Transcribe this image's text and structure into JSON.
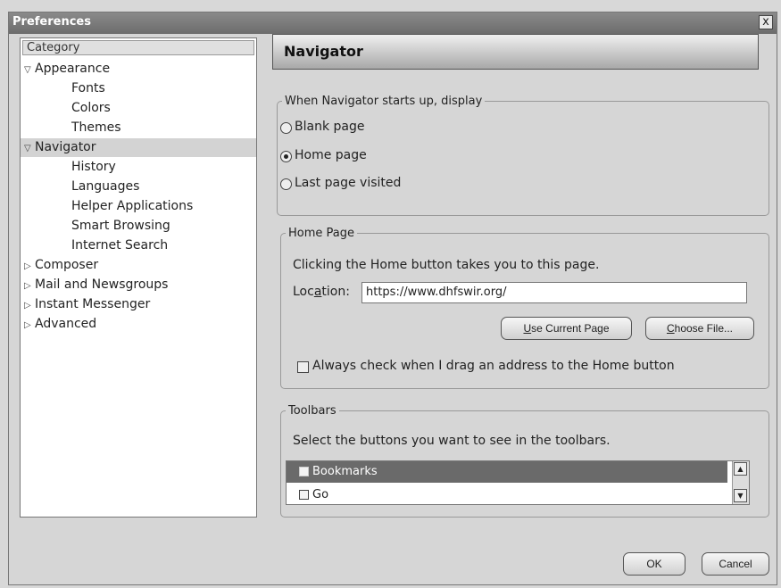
{
  "window": {
    "title": "Preferences",
    "close_label": "x"
  },
  "sidebar": {
    "header": "Category",
    "items": [
      {
        "label": "Appearance",
        "twisty": "▽"
      },
      {
        "label": "Fonts"
      },
      {
        "label": "Colors"
      },
      {
        "label": "Themes"
      },
      {
        "label": "Navigator",
        "twisty": "▽"
      },
      {
        "label": "History"
      },
      {
        "label": "Languages"
      },
      {
        "label": "Helper Applications"
      },
      {
        "label": "Smart Browsing"
      },
      {
        "label": "Internet Search"
      },
      {
        "label": "Composer",
        "twisty": "▷"
      },
      {
        "label": "Mail and Newsgroups",
        "twisty": "▷"
      },
      {
        "label": "Instant Messenger",
        "twisty": "▷"
      },
      {
        "label": "Advanced",
        "twisty": "▷"
      }
    ]
  },
  "panel": {
    "title": "Navigator"
  },
  "startup": {
    "legend": "When Navigator starts up, display",
    "options": [
      {
        "label": "Blank page",
        "selected": false
      },
      {
        "label": "Home page",
        "selected": true
      },
      {
        "label": "Last page visited",
        "selected": false
      }
    ]
  },
  "homepage": {
    "legend": "Home Page",
    "description": "Clicking the Home button takes you to this page.",
    "location_pre": "Loc",
    "location_accel": "a",
    "location_post": "tion:",
    "location_value": "https://www.dhfswir.org/",
    "use_current_accel": "U",
    "use_current_rest": "se Current Page",
    "choose_file_accel": "C",
    "choose_file_rest": "hoose File...",
    "always_check_label": "Always check when I drag an address to the Home button",
    "always_check_checked": false
  },
  "toolbars": {
    "legend": "Toolbars",
    "description": "Select the buttons you want to see in the toolbars.",
    "items": [
      {
        "label": "Bookmarks"
      },
      {
        "label": "Go"
      }
    ]
  },
  "footer": {
    "ok_label": "OK",
    "cancel_label": "Cancel"
  }
}
